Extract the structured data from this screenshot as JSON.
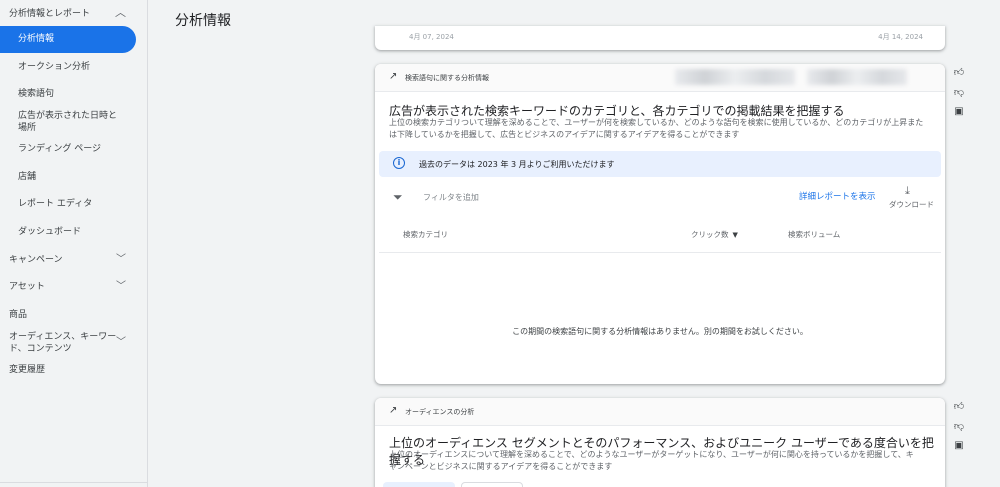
{
  "sidebar": {
    "section_title": "分析情報とレポート",
    "items": [
      {
        "label": "分析情報"
      },
      {
        "label": "オークション分析"
      },
      {
        "label": "検索語句"
      },
      {
        "label": "広告が表示された日時と場所"
      },
      {
        "label": "ランディング ページ"
      },
      {
        "label": "店舗"
      },
      {
        "label": "レポート エディタ"
      },
      {
        "label": "ダッシュボード"
      }
    ],
    "top_items": [
      {
        "label": "キャンペーン"
      },
      {
        "label": "アセット"
      },
      {
        "label": "商品"
      },
      {
        "label": "オーディエンス、キーワード、コンテンツ"
      },
      {
        "label": "変更履歴"
      }
    ]
  },
  "page": {
    "title": "分析情報"
  },
  "top_card": {
    "tick_left": "4月 07, 2024",
    "tick_right": "4月 14, 2024"
  },
  "search_terms_card": {
    "header_label": "検索語句に関する分析情報",
    "title": "広告が表示された検索キーワードのカテゴリと、各カテゴリでの掲載結果を把握する",
    "desc_line1": "上位の検索カテゴリついて理解を深めることで、ユーザーが何を検索しているか、どのような語句を検索に使用しているか、どのカテゴリが上昇また",
    "desc_line2": "は下降しているかを把握して、広告とビジネスのアイデアに関するアイデアを得ることができます",
    "info_text": "過去のデータは 2023 年 3 月よりご利用いただけます",
    "filter_placeholder": "フィルタを追加",
    "detail_report": "詳細レポートを表示",
    "download": "ダウンロード",
    "columns": [
      "検索カテゴリ",
      "クリック数",
      "検索ボリューム"
    ],
    "empty_message": "この期間の検索語句に関する分析情報はありません。別の期間をお試しください。"
  },
  "audience_card": {
    "header_label": "オーディエンスの分析",
    "title": "上位のオーディエンス セグメントとそのパフォーマンス、およびユニーク ユーザーである度合いを把握する",
    "desc_line1": "上位のオーディエンスについて理解を深めることで、どのようなユーザーがターゲットになり、ユーザーが何に関心を持っているかを把握して、キ",
    "desc_line2": "ャンペーンとビジネスに関するアイデアを得ることができます"
  },
  "icons": {
    "chevron_up": "▲",
    "chevron_down": "▼",
    "trend": "trend-icon",
    "info": "i",
    "filter": "▼",
    "download": "⤓"
  },
  "colors": {
    "accent": "#1a73e8",
    "info_bg": "#e8f0fe",
    "bg": "#f1f3f4"
  }
}
